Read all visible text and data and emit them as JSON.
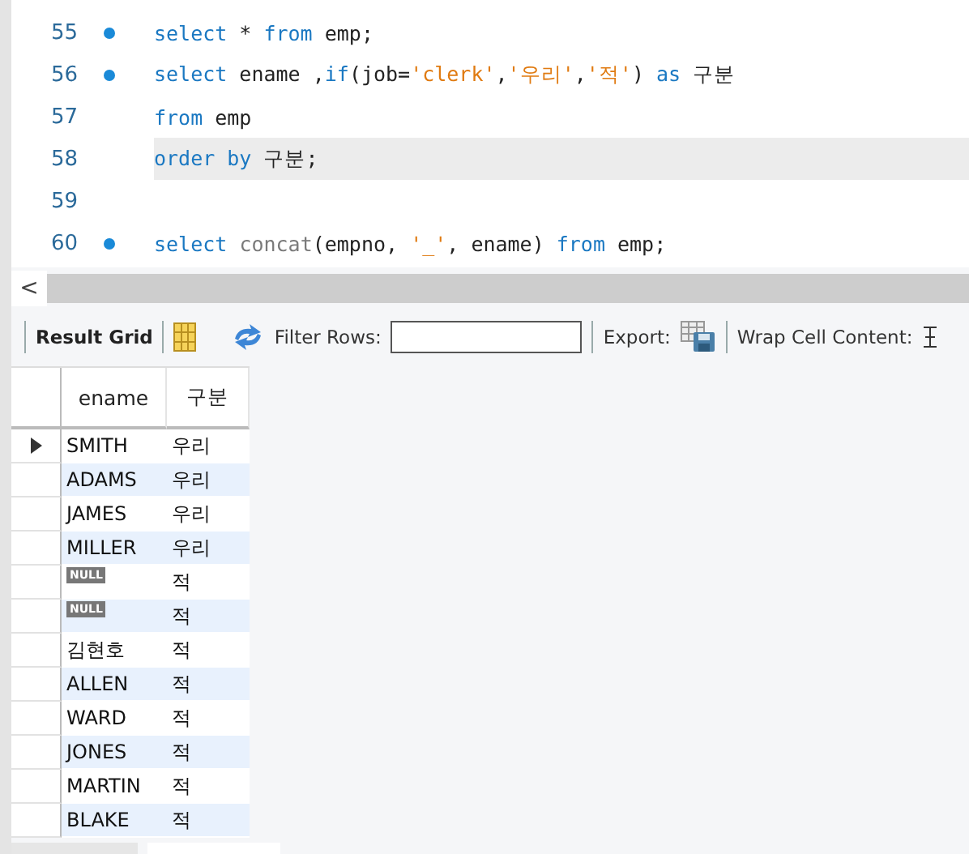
{
  "editor": {
    "lines": [
      {
        "number": "55",
        "statement": true,
        "current": false,
        "tokens": [
          {
            "kind": "keyword",
            "text": "select"
          },
          {
            "kind": "plain",
            "text": " * "
          },
          {
            "kind": "keyword",
            "text": "from"
          },
          {
            "kind": "plain",
            "text": " emp;"
          }
        ]
      },
      {
        "number": "56",
        "statement": true,
        "current": false,
        "tokens": [
          {
            "kind": "keyword",
            "text": "select"
          },
          {
            "kind": "plain",
            "text": " ename ,"
          },
          {
            "kind": "keyword",
            "text": "if"
          },
          {
            "kind": "plain",
            "text": "(job="
          },
          {
            "kind": "string",
            "text": "'clerk'"
          },
          {
            "kind": "plain",
            "text": ","
          },
          {
            "kind": "string",
            "text": "'우리'"
          },
          {
            "kind": "plain",
            "text": ","
          },
          {
            "kind": "string",
            "text": "'적'"
          },
          {
            "kind": "plain",
            "text": ") "
          },
          {
            "kind": "keyword",
            "text": "as"
          },
          {
            "kind": "plain",
            "text": " 구분"
          }
        ]
      },
      {
        "number": "57",
        "statement": false,
        "current": false,
        "tokens": [
          {
            "kind": "keyword",
            "text": "from"
          },
          {
            "kind": "plain",
            "text": " emp"
          }
        ]
      },
      {
        "number": "58",
        "statement": false,
        "current": true,
        "tokens": [
          {
            "kind": "keyword",
            "text": "order by"
          },
          {
            "kind": "plain",
            "text": " 구분;"
          }
        ]
      },
      {
        "number": "59",
        "statement": false,
        "current": false
      },
      {
        "number": "60",
        "statement": true,
        "current": false,
        "tokens": [
          {
            "kind": "keyword",
            "text": "select "
          },
          {
            "kind": "function",
            "text": "concat"
          },
          {
            "kind": "plain",
            "text": "(empno, "
          },
          {
            "kind": "string",
            "text": "'_'"
          },
          {
            "kind": "plain",
            "text": ", ename) "
          },
          {
            "kind": "keyword",
            "text": "from"
          },
          {
            "kind": "plain",
            "text": " emp;"
          }
        ]
      }
    ]
  },
  "scroll_arrow": "<",
  "toolbar": {
    "result_grid": "Result Grid",
    "filter_label": "Filter Rows:",
    "export_label": "Export:",
    "wrap_label": "Wrap Cell Content:"
  },
  "grid": {
    "columns": [
      "ename",
      "구분"
    ],
    "rows": [
      {
        "selected": true,
        "cells": [
          {
            "kind": "text",
            "text": "SMITH"
          },
          {
            "kind": "text",
            "text": "우리"
          }
        ]
      },
      {
        "selected": false,
        "cells": [
          {
            "kind": "text",
            "text": "ADAMS"
          },
          {
            "kind": "text",
            "text": "우리"
          }
        ]
      },
      {
        "selected": false,
        "cells": [
          {
            "kind": "text",
            "text": "JAMES"
          },
          {
            "kind": "text",
            "text": "우리"
          }
        ]
      },
      {
        "selected": false,
        "cells": [
          {
            "kind": "text",
            "text": "MILLER"
          },
          {
            "kind": "text",
            "text": "우리"
          }
        ]
      },
      {
        "selected": false,
        "cells": [
          {
            "kind": "null",
            "text": "NULL"
          },
          {
            "kind": "text",
            "text": "적"
          }
        ]
      },
      {
        "selected": false,
        "cells": [
          {
            "kind": "null",
            "text": "NULL"
          },
          {
            "kind": "text",
            "text": "적"
          }
        ]
      },
      {
        "selected": false,
        "cells": [
          {
            "kind": "text",
            "text": "김현호"
          },
          {
            "kind": "text",
            "text": "적"
          }
        ]
      },
      {
        "selected": false,
        "cells": [
          {
            "kind": "text",
            "text": "ALLEN"
          },
          {
            "kind": "text",
            "text": "적"
          }
        ]
      },
      {
        "selected": false,
        "cells": [
          {
            "kind": "text",
            "text": "WARD"
          },
          {
            "kind": "text",
            "text": "적"
          }
        ]
      },
      {
        "selected": false,
        "cells": [
          {
            "kind": "text",
            "text": "JONES"
          },
          {
            "kind": "text",
            "text": "적"
          }
        ]
      },
      {
        "selected": false,
        "cells": [
          {
            "kind": "text",
            "text": "MARTIN"
          },
          {
            "kind": "text",
            "text": "적"
          }
        ]
      },
      {
        "selected": false,
        "cells": [
          {
            "kind": "text",
            "text": "BLAKE"
          },
          {
            "kind": "text",
            "text": "적"
          }
        ]
      }
    ]
  },
  "result_tabs": [
    {
      "selected": false
    },
    {
      "selected": true
    }
  ]
}
